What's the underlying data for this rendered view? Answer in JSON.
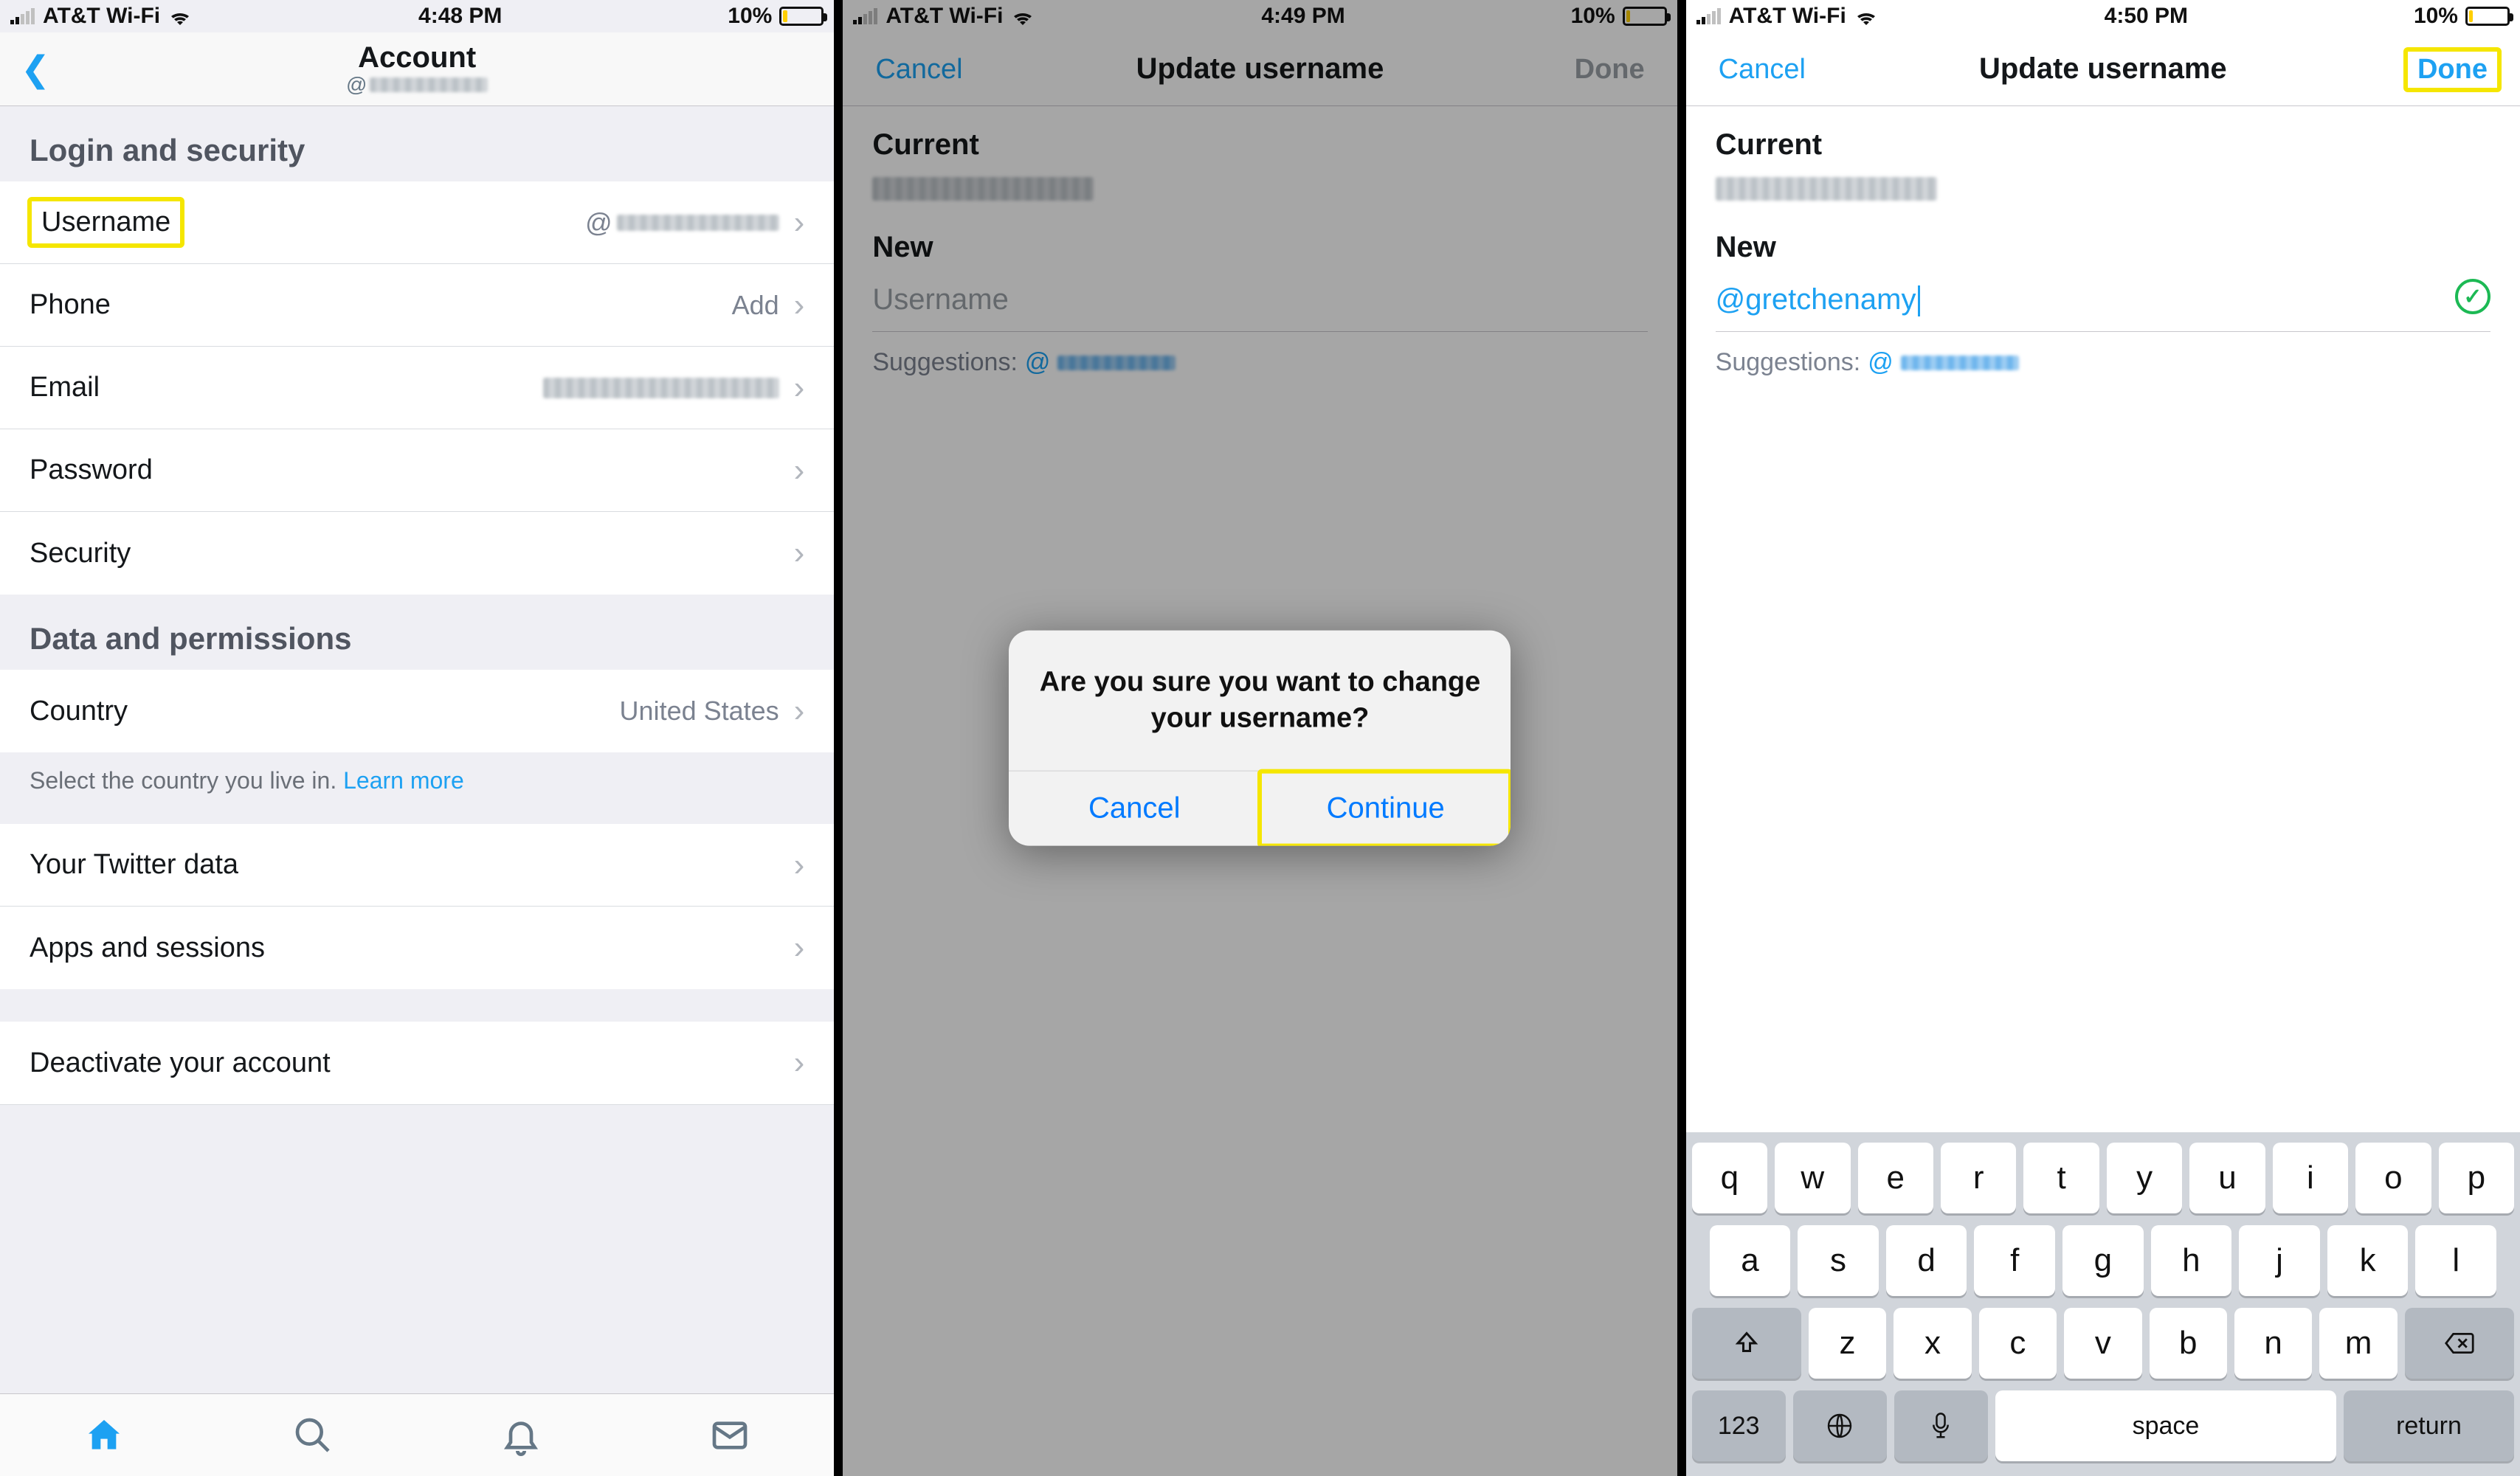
{
  "status": {
    "carrier": "AT&T Wi-Fi",
    "battery_pct": "10%",
    "times": [
      "4:48 PM",
      "4:49 PM",
      "4:50 PM"
    ]
  },
  "screen1": {
    "title": "Account",
    "sub_prefix": "@",
    "sections": {
      "login": {
        "header": "Login and security",
        "rows": {
          "username": {
            "label": "Username",
            "value_prefix": "@"
          },
          "phone": {
            "label": "Phone",
            "value": "Add"
          },
          "email": {
            "label": "Email"
          },
          "password": {
            "label": "Password"
          },
          "security": {
            "label": "Security"
          }
        }
      },
      "data": {
        "header": "Data and permissions",
        "rows": {
          "country": {
            "label": "Country",
            "value": "United States"
          },
          "hint": "Select the country you live in.",
          "learn_more": "Learn more",
          "twitter_data": {
            "label": "Your Twitter data"
          },
          "apps": {
            "label": "Apps and sessions"
          },
          "deactivate": {
            "label": "Deactivate your account"
          }
        }
      }
    }
  },
  "screen2": {
    "cancel": "Cancel",
    "done": "Done",
    "title": "Update username",
    "current_label": "Current",
    "new_label": "New",
    "placeholder": "Username",
    "suggestions_label": "Suggestions:",
    "at": "@",
    "alert_msg": "Are you sure you want to change your username?",
    "alert_cancel": "Cancel",
    "alert_continue": "Continue"
  },
  "screen3": {
    "cancel": "Cancel",
    "done": "Done",
    "title": "Update username",
    "current_label": "Current",
    "new_label": "New",
    "new_value": "@gretchenamy",
    "suggestions_label": "Suggestions:",
    "at": "@",
    "keyboard": {
      "row1": [
        "q",
        "w",
        "e",
        "r",
        "t",
        "y",
        "u",
        "i",
        "o",
        "p"
      ],
      "row2": [
        "a",
        "s",
        "d",
        "f",
        "g",
        "h",
        "j",
        "k",
        "l"
      ],
      "row3": [
        "z",
        "x",
        "c",
        "v",
        "b",
        "n",
        "m"
      ],
      "fn": {
        "num": "123",
        "space": "space",
        "return": "return"
      }
    }
  }
}
